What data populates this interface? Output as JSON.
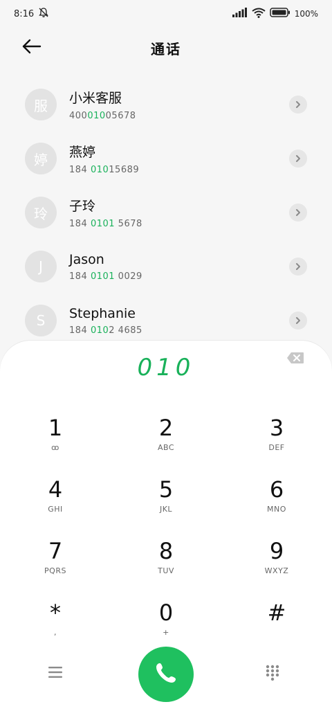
{
  "status": {
    "time": "8:16",
    "battery": "100%",
    "icons": [
      "bell-off-icon",
      "signal-icon",
      "wifi-icon",
      "battery-icon"
    ]
  },
  "header": {
    "title": "通话",
    "back_icon": "arrow-left-icon"
  },
  "contacts": [
    {
      "avatar": "服",
      "name": "小米客服",
      "number_pre": "400",
      "number_hl": "010",
      "number_post": "05678"
    },
    {
      "avatar": "婷",
      "name": "燕婷",
      "number_pre": "184 ",
      "number_hl": "010",
      "number_post": "15689"
    },
    {
      "avatar": "玲",
      "name": "子玲",
      "number_pre": "184 ",
      "number_hl": "0101",
      "number_post": " 5678"
    },
    {
      "avatar": "J",
      "name": "Jason",
      "number_pre": "184 ",
      "number_hl": "0101",
      "number_post": " 0029"
    },
    {
      "avatar": "S",
      "name": "Stephanie",
      "number_pre": "184 ",
      "number_hl": "010",
      "number_post": "2 4685"
    }
  ],
  "dialpad": {
    "digits": "010",
    "keys": [
      {
        "digit": "1",
        "letters": "ꝏ"
      },
      {
        "digit": "2",
        "letters": "ABC"
      },
      {
        "digit": "3",
        "letters": "DEF"
      },
      {
        "digit": "4",
        "letters": "GHI"
      },
      {
        "digit": "5",
        "letters": "JKL"
      },
      {
        "digit": "6",
        "letters": "MNO"
      },
      {
        "digit": "7",
        "letters": "PQRS"
      },
      {
        "digit": "8",
        "letters": "TUV"
      },
      {
        "digit": "9",
        "letters": "WXYZ"
      },
      {
        "digit": "*",
        "letters": ","
      },
      {
        "digit": "0",
        "letters": "+"
      },
      {
        "digit": "#",
        "letters": ""
      }
    ]
  },
  "colors": {
    "accent": "#19b15a",
    "call_button": "#1fc05f"
  }
}
